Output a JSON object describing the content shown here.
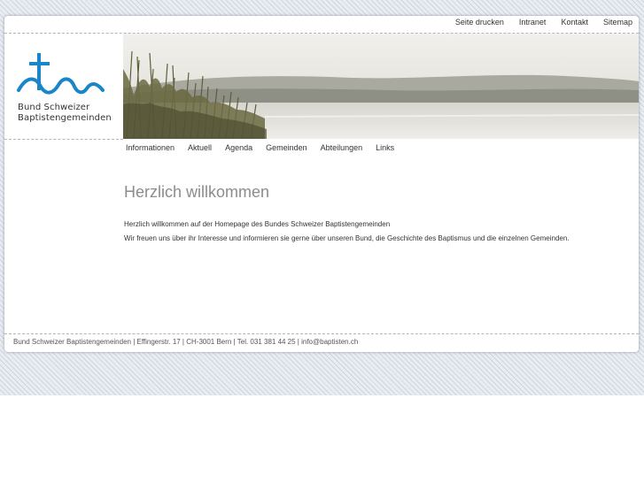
{
  "top_nav": [
    "Seite drucken",
    "Intranet",
    "Kontakt",
    "Sitemap"
  ],
  "logo": {
    "line1": "Bund Schweizer",
    "line2": "Baptistengemeinden",
    "icon": "cross-waves-icon",
    "color": "#1a86c8"
  },
  "hero": {
    "description_icon": "lake-landscape-image"
  },
  "main_nav": [
    "Informationen",
    "Aktuell",
    "Agenda",
    "Gemeinden",
    "Abteilungen",
    "Links"
  ],
  "content": {
    "title": "Herzlich willkommen",
    "paragraph1": "Herzlich willkommen auf der Homepage des Bundes Schweizer Baptistengemeinden",
    "paragraph2": "Wir freuen uns über ihr Interesse und informieren sie gerne über unseren Bund, die Geschichte des Baptismus und die einzelnen Gemeinden."
  },
  "footer": "Bund Schweizer Baptistengemeinden | Effingerstr. 17 | CH-3001 Bern | Tel. 031 381 44 25 | info@baptisten.ch"
}
